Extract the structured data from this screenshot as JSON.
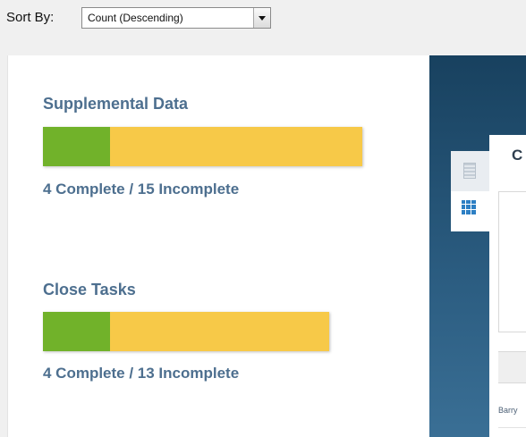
{
  "sort": {
    "label": "Sort By:",
    "selected": "Count (Descending)"
  },
  "metrics": [
    {
      "title": "Supplemental Data",
      "counts": "4 Complete / 15 Incomplete",
      "complete": 4,
      "incomplete": 15
    },
    {
      "title": "Close Tasks",
      "counts": "4 Complete / 13 Incomplete",
      "complete": 4,
      "incomplete": 13
    }
  ],
  "colors": {
    "complete": "#71b22a",
    "incomplete": "#f7c948",
    "heading": "#4d6f8f",
    "dark_panel": "#1f4a6b"
  },
  "right_panel": {
    "card_title": "C",
    "row_text": "Barry",
    "tabs": [
      {
        "icon": "list-icon"
      },
      {
        "icon": "grid-icon"
      }
    ]
  }
}
